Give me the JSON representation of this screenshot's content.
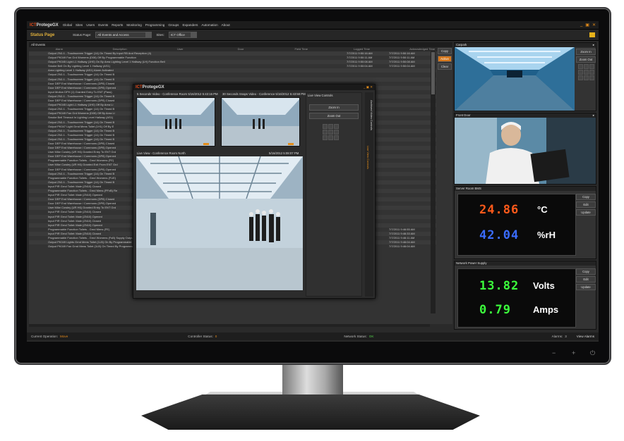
{
  "app": {
    "logo_brand": "ICT",
    "logo_name": "ProtegeGX",
    "nav": [
      "Global",
      "Sites",
      "Users",
      "Events",
      "Reports",
      "Monitoring",
      "Programming",
      "Groups",
      "Expanders",
      "Automation",
      "About"
    ],
    "window_buttons": [
      "_",
      "▣",
      "✕"
    ]
  },
  "toolbar": {
    "page_title": "Status Page",
    "status_page_label": "Status Page:",
    "status_page_value": "All Events and Access",
    "sites_label": "Sites:",
    "sites_value": "ICT Office"
  },
  "events": {
    "title": "All Events",
    "columns": [
      "Alarm",
      "Description",
      "User",
      "Door",
      "Field Time",
      "Logged Time",
      "Acknowledged Time"
    ],
    "rows": [
      {
        "d": "Output ZN1:1 - Touchscreen Trigger (14) On Timed By Input RB And Reception (4)",
        "t1": "7/7/2011 9:50:16 AM",
        "t2": "7/7/2011 9:50:16 AM"
      },
      {
        "d": "Output PK049 Fan Grd Womens (D08) Off By Programmable Function",
        "t1": "7/7/2011 9:50:11 AM",
        "t2": "7/7/2011 9:50:11 AM"
      },
      {
        "d": "Output PK045 Light L1 Hallway (1H0) On By Area Lighting Level 1 Hallway (LH) Function Bell",
        "t1": "7/7/2011 9:50:08 AM",
        "t2": "7/7/2011 9:50:08 AM"
      },
      {
        "d": "Smoke Bell On By Lighting Level 1 Hallway (AS1)",
        "t1": "7/7/2011 9:50:04 AM",
        "t2": "7/7/2011 9:50:04 AM"
      },
      {
        "d": "Area Lighting Level 1 Hallway (AS1) Alarm Activated",
        "t1": "",
        "t2": ""
      },
      {
        "d": "Output ZN1:1 - Touchscreen Trigger (14) On Timed B",
        "t1": "",
        "t2": ""
      },
      {
        "d": "Output ZN1:1 - Touchscreen Trigger (14) On Timed B",
        "t1": "",
        "t2": ""
      },
      {
        "d": "Door DEP End Warehouse / Commons (DP8) Closed",
        "t1": "",
        "t2": ""
      },
      {
        "d": "Door DEP End Warehouse / Commons (DP8) Opened",
        "t1": "",
        "t2": ""
      },
      {
        "d": "Input Motion DPH (1) Granted Entry To ENT (Pass)",
        "t1": "",
        "t2": ""
      },
      {
        "d": "Output ZN1:1 - Touchscreen Trigger (14) On Timed B",
        "t1": "",
        "t2": ""
      },
      {
        "d": "Door DEP End Warehouse / Commons (DP8) Closed",
        "t1": "",
        "t2": ""
      },
      {
        "d": "Output PK045 Light L1 Hallway (1H0) Off By Area Li",
        "t1": "",
        "t2": ""
      },
      {
        "d": "Output ZN1:1 - Touchscreen Trigger (14) On Timed B",
        "t1": "",
        "t2": ""
      },
      {
        "d": "Output PK049 Fan Grd Womens (D08) Off By Area Li",
        "t1": "",
        "t2": ""
      },
      {
        "d": "Smoke Bell Timeout In Lighting Level Hallway (AS1)",
        "t1": "",
        "t2": ""
      },
      {
        "d": "Output ZN1:1 - Touchscreen Trigger (14) On Timed B",
        "t1": "",
        "t2": ""
      },
      {
        "d": "Output PK047 Light Grnd Mens Toilet (1H1) Off By E",
        "t1": "",
        "t2": ""
      },
      {
        "d": "Output ZN1:1 - Touchscreen Trigger (14) On Timed B",
        "t1": "",
        "t2": ""
      },
      {
        "d": "Output ZN1:1 - Touchscreen Trigger (14) On Timed B",
        "t1": "",
        "t2": ""
      },
      {
        "d": "Output ZN1:1 - Touchscreen Trigger (14) On Timed B",
        "t1": "",
        "t2": ""
      },
      {
        "d": "Door DEP End Warehouse / Commons (DP8) Closed",
        "t1": "",
        "t2": ""
      },
      {
        "d": "Door DEP End Warehouse / Commons (DP8) Opened",
        "t1": "",
        "t2": ""
      },
      {
        "d": "User Mike Cowley (UR H6) Granted Entry To ENT Grd",
        "t1": "",
        "t2": ""
      },
      {
        "d": "Door DEP End Warehouse / Commons (DP8) Opened",
        "t1": "",
        "t2": ""
      },
      {
        "d": "Programmable Function Toilets - Grnd Womens (FE)",
        "t1": "",
        "t2": ""
      },
      {
        "d": "User Mike Cowley (UR H6) Granted Exit From ENT Grd",
        "t1": "",
        "t2": ""
      },
      {
        "d": "Door DEP End Warehouse / Commons (DP8) Opened",
        "t1": "",
        "t2": ""
      },
      {
        "d": "Output ZN1:1 - Touchscreen Trigger (14) On Timed B",
        "t1": "",
        "t2": ""
      },
      {
        "d": "Programmable Function Toilets - Grnd Womens (FUE)",
        "t1": "",
        "t2": ""
      },
      {
        "d": "Output ZN1:1 - Touchscreen Trigger (14) On Timed B",
        "t1": "",
        "t2": ""
      },
      {
        "d": "Input PIR Grnd Toilet: Male (ZN10) Closed",
        "t1": "",
        "t2": ""
      },
      {
        "d": "Programmable Function Toilets - Grnd Mens (PFxB) Re",
        "t1": "",
        "t2": ""
      },
      {
        "d": "Input PIR Grnd Toilet: Male (ZN10) Opened",
        "t1": "",
        "t2": ""
      },
      {
        "d": "Door DEP End Warehouse / Commons (DP8) Closed",
        "t1": "",
        "t2": ""
      },
      {
        "d": "Door DEP End Warehouse / Commons (DP8) Opened",
        "t1": "",
        "t2": ""
      },
      {
        "d": "User Mike Cowley (UR H6) Granted Entry To ENT Grd",
        "t1": "",
        "t2": ""
      },
      {
        "d": "Input PIR Grnd Toilet: Male (ZN10) Closed",
        "t1": "",
        "t2": ""
      },
      {
        "d": "Input PIR Grnd Toilet: Male (ZN10) Opened",
        "t1": "",
        "t2": ""
      },
      {
        "d": "Input PIR Grnd Toilet: Male (ZN10) Closed",
        "t1": "",
        "t2": ""
      },
      {
        "d": "Input PIR Grnd Toilet: Male (ZN10) Opened",
        "t1": "",
        "t2": ""
      },
      {
        "d": "Programmable Function Toilets - Grnd Mens (FE)",
        "t1": "7/7/2011 9:46:55 AM",
        "t2": "7/7/2011 9:46:55 AM"
      },
      {
        "d": "Input PIR Grnd Toilet: Male (ZN10) Closed",
        "t1": "7/7/2011 9:46:33 AM",
        "t2": "7/7/2011 9:46:33 AM"
      },
      {
        "d": "Programmable Function Toilets - Grnd Womens (FsB) Supply Output Off Started",
        "t1": "7/7/2011 9:46:14 AM",
        "t2": "7/7/2011 9:46:11 AM"
      },
      {
        "d": "Output PK049 Lights Grnd Mens Toilet (1LB) On By Programmable Function",
        "t1": "7/7/2011 9:46:04 AM",
        "t2": "7/7/2011 9:46:04 AM"
      },
      {
        "d": "Output PK049 Fan Grnd Mens Toilet (1LB) On Timed By Programmable Function",
        "t1": "7/7/2011 9:46:04 AM",
        "t2": "7/7/2011 9:46:04 AM"
      }
    ],
    "side_buttons": [
      "Copy",
      "Active",
      "Clear"
    ]
  },
  "status_bar": {
    "operation_label": "Current Operation:",
    "operation_value": "Move",
    "controller_label": "Controller Status:",
    "controller_value": "0",
    "network_label": "Network Status:",
    "network_value": "OK",
    "alarms_label": "Alarms:",
    "alarms_value": "3",
    "view_alarms": "View Alarms"
  },
  "carpark": {
    "title": "Carpark",
    "zoom_in": "Zoom In",
    "zoom_out": "Zoom Out"
  },
  "front_door": {
    "title": "Front Door"
  },
  "server_room": {
    "title": "Server Room BMS",
    "temp_value": "24.86",
    "temp_unit": "°C",
    "humidity_value": "42.04",
    "humidity_unit": "%rH",
    "buttons": [
      "Copy",
      "Edit",
      "Update"
    ]
  },
  "power": {
    "title": "Network Power Supply",
    "volts_value": "13.82",
    "volts_unit": "Volts",
    "amps_value": "0.79",
    "amps_unit": "Amps",
    "buttons": [
      "Copy",
      "Edit",
      "Update"
    ]
  },
  "video_window": {
    "title": "ProtegeGX",
    "thumb1_label": "5 Seconds Video - Conference Room",
    "thumb1_time": "5/16/2012 5:43:16 PM",
    "thumb2_label": "30 Seconds Snaps Video - Conference",
    "thumb2_time": "5/16/2012 5:43:58 PM",
    "live_label": "Live View - Conference Room North",
    "live_time": "5/16/2012 5:08:07 PM",
    "controls_title": "Live View Controls",
    "zoom_in": "Zoom In",
    "zoom_out": "Zoom Out",
    "tab1": "Archived Video Controls",
    "tab2": "Live View Controls"
  },
  "colors": {
    "accent": "#e28c1a",
    "temp": "#ff5a1a",
    "humidity": "#3a6cff",
    "power": "#3cff3c"
  }
}
